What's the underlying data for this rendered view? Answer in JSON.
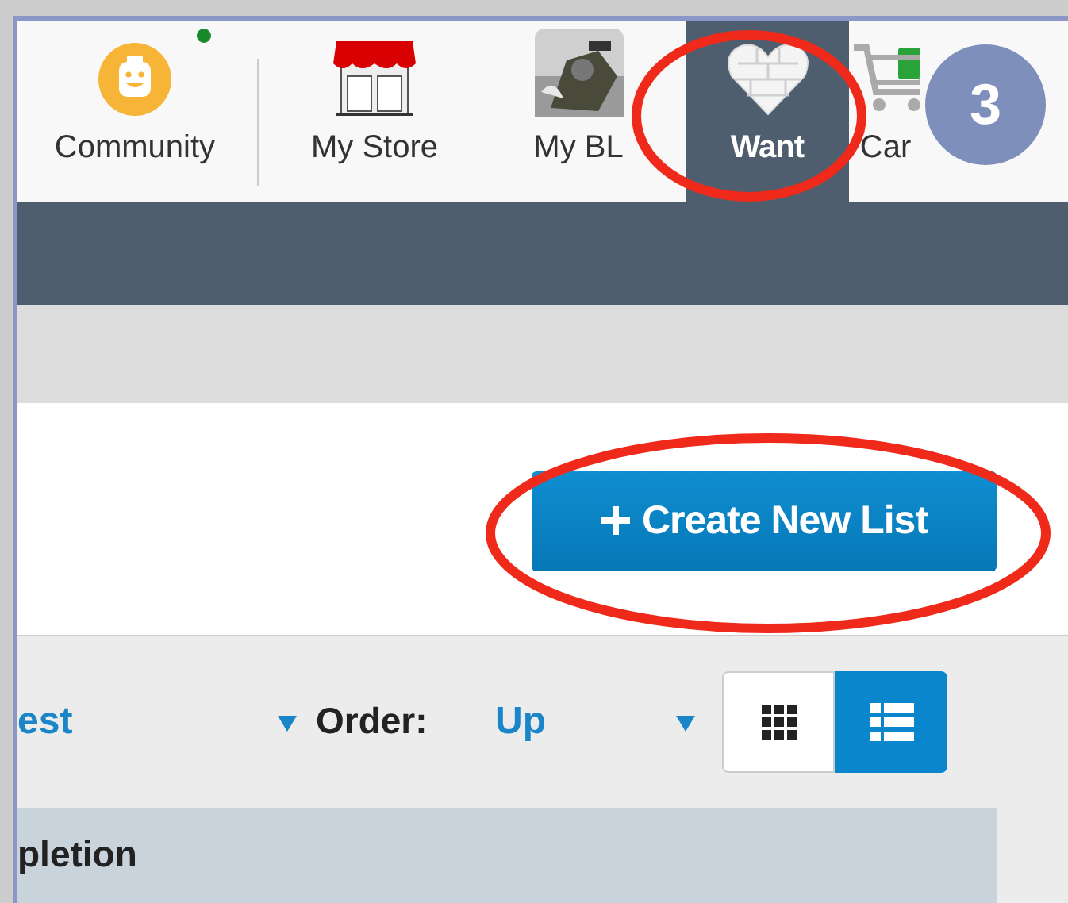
{
  "nav": {
    "items": [
      {
        "label": "Community",
        "kind": "community",
        "selected": false,
        "notification": true
      },
      {
        "label": "My Store",
        "kind": "store",
        "selected": false,
        "notification": false
      },
      {
        "label": "My BL",
        "selected": false,
        "notification": false
      },
      {
        "label": "Want",
        "kind": "heart",
        "selected": true,
        "notification": false
      },
      {
        "label": "Car",
        "kind": "cart",
        "selected": false,
        "notification": false
      }
    ]
  },
  "create_button": {
    "label": "Create New List"
  },
  "sort": {
    "value": "est"
  },
  "order": {
    "label": "Order:",
    "value": "Up"
  },
  "views": [
    {
      "kind": "grid",
      "selected": false
    },
    {
      "kind": "list",
      "selected": true
    }
  ],
  "table": {
    "columns": [
      "pletion"
    ]
  },
  "annotation": {
    "badge": "3"
  }
}
